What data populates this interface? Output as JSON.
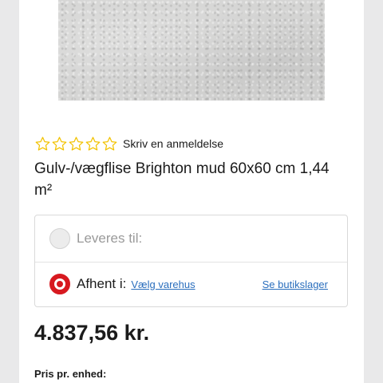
{
  "product": {
    "image_icon": "product-photo-grey-tile",
    "rating": {
      "stars_filled": 0,
      "stars_total": 5,
      "review_link": "Skriv en anmeldelse"
    },
    "title": "Gulv-/vægflise Brighton mud 60x60 cm 1,44 m²"
  },
  "delivery": {
    "ship_label": "Leveres til:",
    "pickup_label": "Afhent i:",
    "choose_store_link": "Vælg varehus",
    "stock_link": "Se butikslager",
    "selected": "pickup"
  },
  "price": {
    "value": "4.837,56 kr.",
    "unit_label": "Pris pr. enhed:"
  },
  "colors": {
    "accent_red": "#d71920",
    "link_blue": "#2a6ebd",
    "star_yellow": "#f2c200"
  }
}
